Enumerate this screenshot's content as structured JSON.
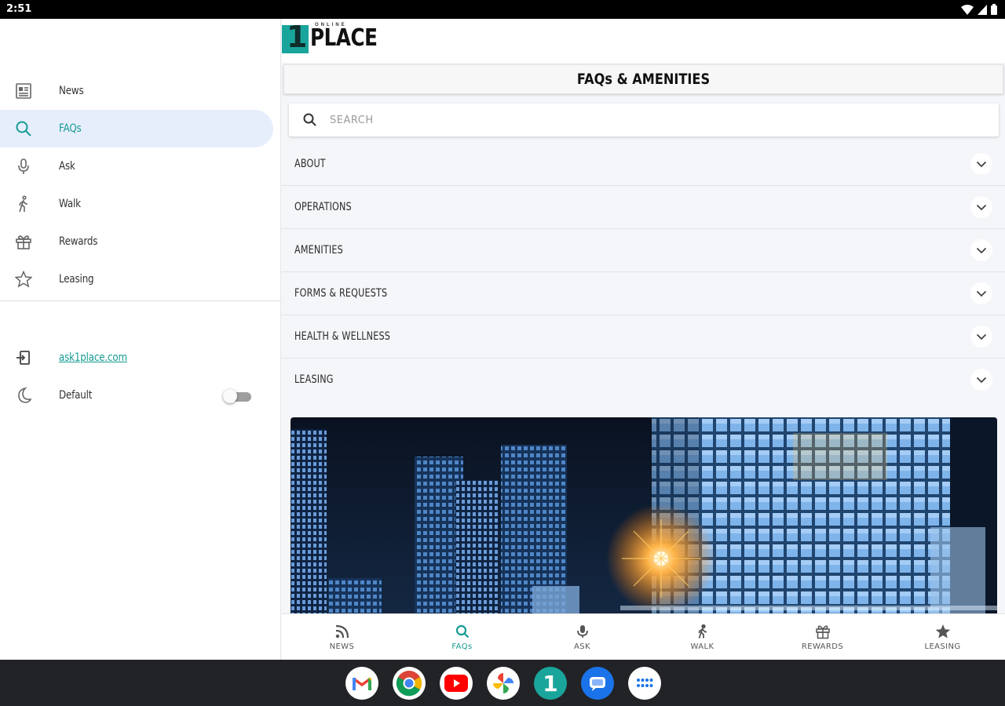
{
  "status_bar": {
    "time": "2:51"
  },
  "drawer": {
    "items": [
      {
        "label": "News",
        "icon": "news-icon"
      },
      {
        "label": "FAQs",
        "icon": "search-icon",
        "active": true
      },
      {
        "label": "Ask",
        "icon": "microphone-icon"
      },
      {
        "label": "Walk",
        "icon": "walk-icon"
      },
      {
        "label": "Rewards",
        "icon": "gift-icon"
      },
      {
        "label": "Leasing",
        "icon": "star-icon"
      }
    ],
    "link": {
      "label": "ask1place.com",
      "icon": "exit-icon"
    },
    "theme": {
      "label": "Default",
      "icon": "moon-icon",
      "enabled": false
    }
  },
  "header": {
    "logo_text": "PLACE",
    "logo_mark": "1",
    "logo_small": "ONLINE"
  },
  "page": {
    "title": "FAQs & AMENITIES",
    "search_placeholder": "SEARCH"
  },
  "faq_sections": [
    {
      "label": "ABOUT"
    },
    {
      "label": "OPERATIONS"
    },
    {
      "label": "AMENITIES"
    },
    {
      "label": "FORMS & REQUESTS"
    },
    {
      "label": "HEALTH & WELLNESS"
    },
    {
      "label": "LEASING"
    }
  ],
  "bottom_nav": [
    {
      "label": "NEWS",
      "icon": "rss-icon"
    },
    {
      "label": "FAQs",
      "icon": "search-icon",
      "active": true
    },
    {
      "label": "ASK",
      "icon": "microphone-icon"
    },
    {
      "label": "WALK",
      "icon": "walk-icon"
    },
    {
      "label": "REWARDS",
      "icon": "gift-icon"
    },
    {
      "label": "LEASING",
      "icon": "star-icon"
    }
  ],
  "dock": [
    "gmail-icon",
    "chrome-icon",
    "youtube-icon",
    "photos-icon",
    "one-place-app-icon",
    "messages-icon",
    "app-drawer-icon"
  ],
  "colors": {
    "accent": "#169b93",
    "active_bg": "#e6eefc",
    "taskbar": "#222326"
  }
}
